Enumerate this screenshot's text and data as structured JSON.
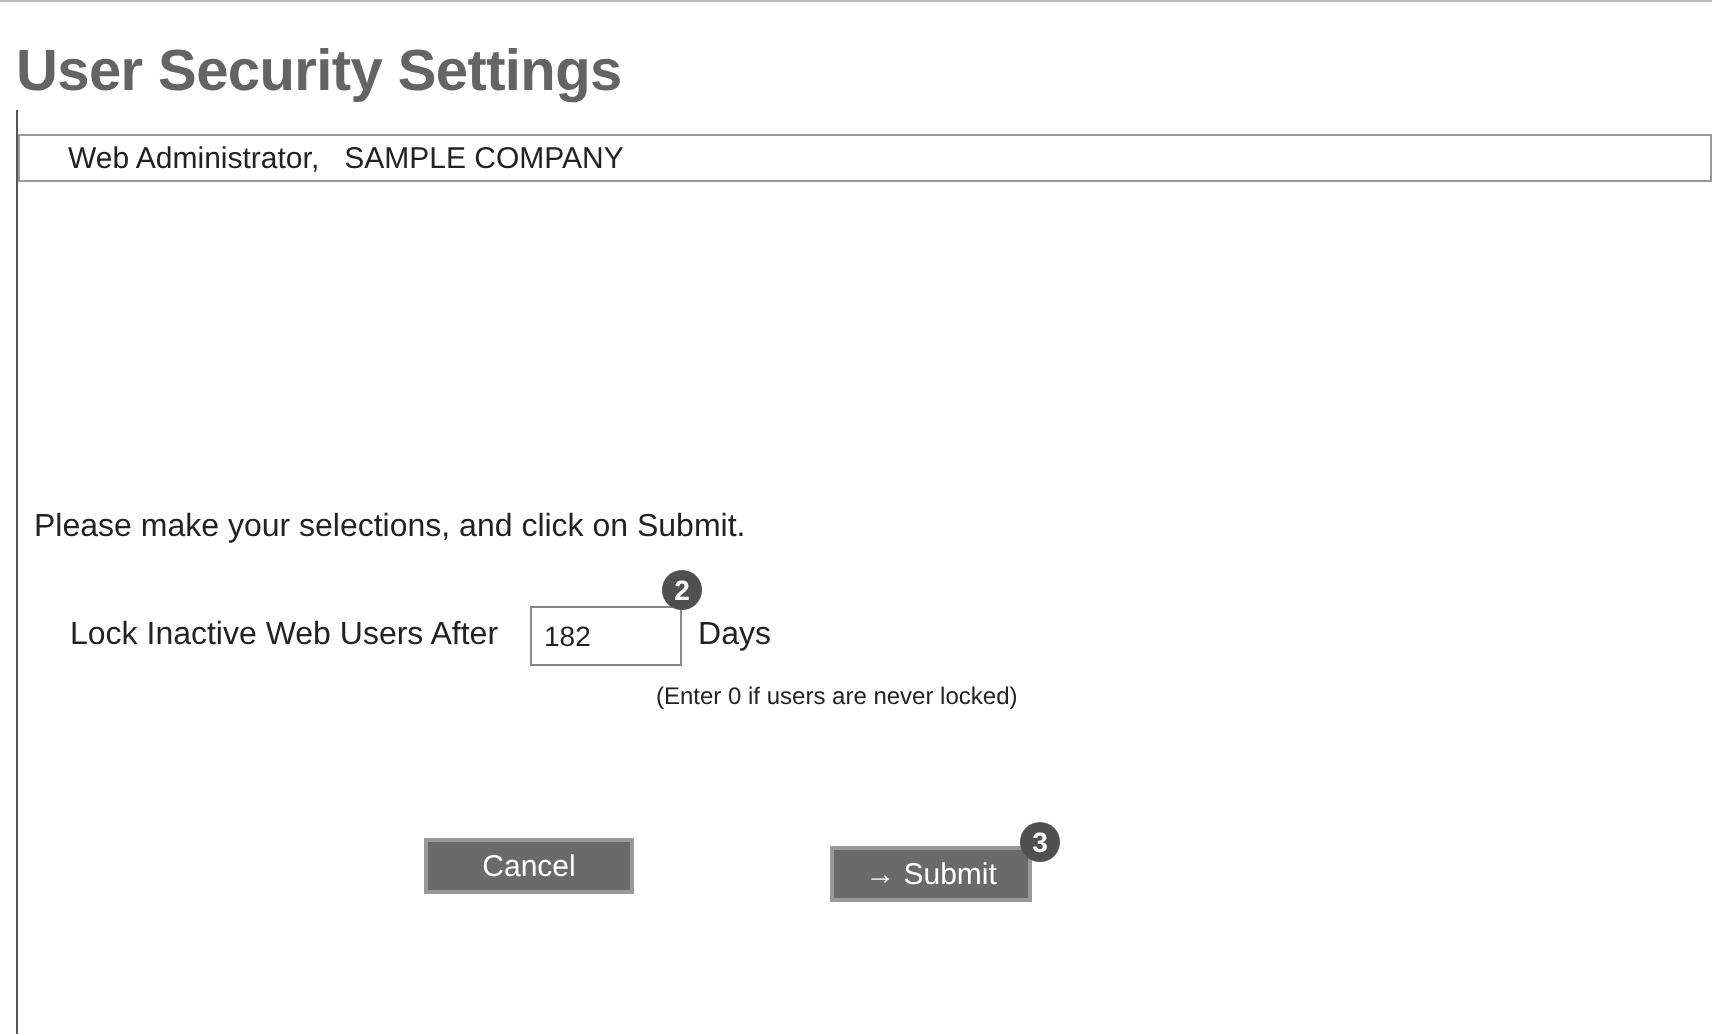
{
  "title": "User Security Settings",
  "user_bar": "Web Administrator,   SAMPLE COMPANY",
  "instruction": "Please make your selections, and click on Submit.",
  "lock_setting": {
    "label": "Lock Inactive Web Users After",
    "value": "182",
    "unit": "Days",
    "hint": "(Enter 0 if users are never locked)",
    "badge": "2"
  },
  "buttons": [
    {
      "label": "Cancel",
      "kind": "cancel"
    },
    {
      "label": "→ Submit",
      "kind": "submit",
      "badge": "3"
    }
  ]
}
